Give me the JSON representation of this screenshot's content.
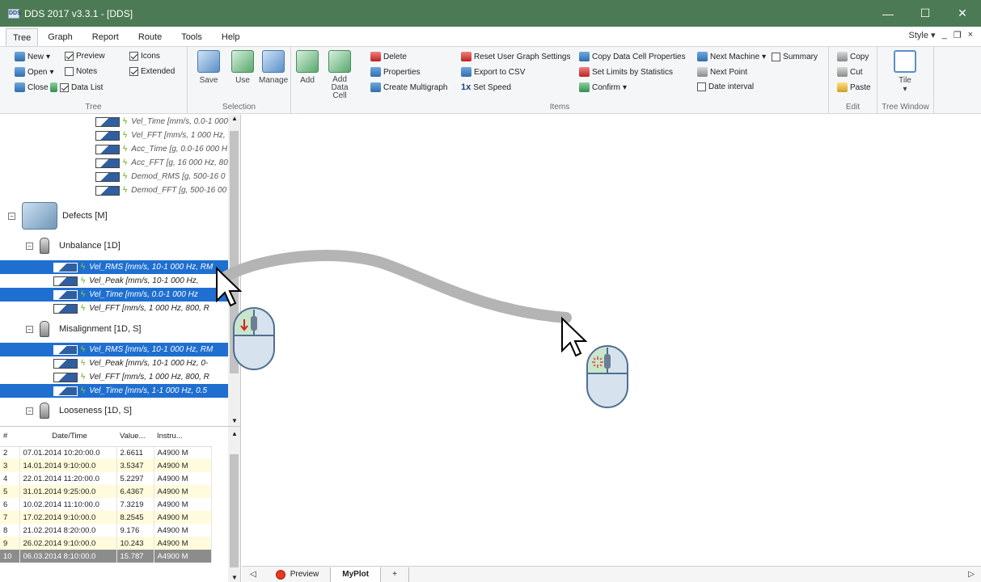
{
  "window": {
    "title": "DDS 2017 v3.3.1 - [DDS]",
    "app_icon": "DDS",
    "min": "—",
    "max": "☐",
    "close": "✕"
  },
  "menu": {
    "tabs": [
      "Tree",
      "Graph",
      "Report",
      "Route",
      "Tools",
      "Help"
    ],
    "style_label": "Style"
  },
  "ribbon": {
    "tree": {
      "new": "New",
      "open": "Open",
      "close": "Close",
      "preview": "Preview",
      "notes": "Notes",
      "data_list": "Data List",
      "icons": "Icons",
      "extended": "Extended",
      "label": "Tree"
    },
    "selection": {
      "save": "Save",
      "use": "Use",
      "manage": "Manage",
      "label": "Selection"
    },
    "items": {
      "add": "Add",
      "add_data_cell": "Add Data Cell",
      "delete": "Delete",
      "properties": "Properties",
      "create_multigraph": "Create Multigraph",
      "reset_user_graph": "Reset User Graph Settings",
      "export_csv": "Export to CSV",
      "set_speed": "Set Speed",
      "set_speed_prefix": "1x",
      "copy_data_cell": "Copy Data Cell Properties",
      "set_limits": "Set Limits by Statistics",
      "confirm": "Confirm",
      "next_machine": "Next Machine",
      "summary": "Summary",
      "next_point": "Next Point",
      "date_interval": "Date interval",
      "label": "Items"
    },
    "edit": {
      "copy": "Copy",
      "cut": "Cut",
      "paste": "Paste",
      "label": "Edit"
    },
    "tree_window": {
      "tile": "Tile",
      "label": "Tree Window"
    }
  },
  "tree": {
    "top_items": [
      "Vel_Time [mm/s, 0.0-1 000",
      "Vel_FFT [mm/s, 1 000 Hz,",
      "Acc_Time [g, 0.0-16 000 H",
      "Acc_FFT [g, 16 000 Hz, 80",
      "Demod_RMS [g, 500-16 0",
      "Demod_FFT [g, 500-16 00"
    ],
    "defects": "Defects [M]",
    "unbalance": "Unbalance [1D]",
    "unbalance_items": [
      "Vel_RMS [mm/s, 10-1 000 Hz, RM",
      "Vel_Peak [mm/s, 10-1 000 Hz,",
      "Vel_Time [mm/s, 0.0-1 000 Hz",
      "Vel_FFT [mm/s, 1 000 Hz, 800, R"
    ],
    "misalignment": "Misalignment [1D, S]",
    "misalignment_items": [
      "Vel_RMS [mm/s, 10-1 000 Hz, RM",
      "Vel_Peak [mm/s, 10-1 000 Hz, 0-",
      "Vel_FFT [mm/s, 1 000 Hz, 800, R",
      "Vel_Time [mm/s, 1-1 000 Hz, 0.5"
    ],
    "looseness": "Looseness [1D, S]"
  },
  "datalist": {
    "headers": [
      "#",
      "Date/Time",
      "Value...",
      "Instru..."
    ],
    "rows": [
      [
        "2",
        "07.01.2014 10:20:00.0",
        "2.6611",
        "A4900 M"
      ],
      [
        "3",
        "14.01.2014 9:10:00.0",
        "3.5347",
        "A4900 M"
      ],
      [
        "4",
        "22.01.2014 11:20:00.0",
        "5.2297",
        "A4900 M"
      ],
      [
        "5",
        "31.01.2014 9:25:00.0",
        "6.4367",
        "A4900 M"
      ],
      [
        "6",
        "10.02.2014 11:10:00.0",
        "7.3219",
        "A4900 M"
      ],
      [
        "7",
        "17.02.2014 9:10:00.0",
        "8.2545",
        "A4900 M"
      ],
      [
        "8",
        "21.02.2014 8:20:00.0",
        "9.176",
        "A4900 M"
      ],
      [
        "9",
        "26.02.2014 9:10:00.0",
        "10.243",
        "A4900 M"
      ],
      [
        "10",
        "06.03.2014 8:10:00.0",
        "15.787",
        "A4900 M"
      ]
    ]
  },
  "bottom_tabs": {
    "preview": "Preview",
    "myplot": "MyPlot",
    "add": "+"
  },
  "colors": {
    "titlebar": "#4c7a54",
    "selection": "#1f6fd0",
    "drag_path": "#b4b4b4"
  }
}
